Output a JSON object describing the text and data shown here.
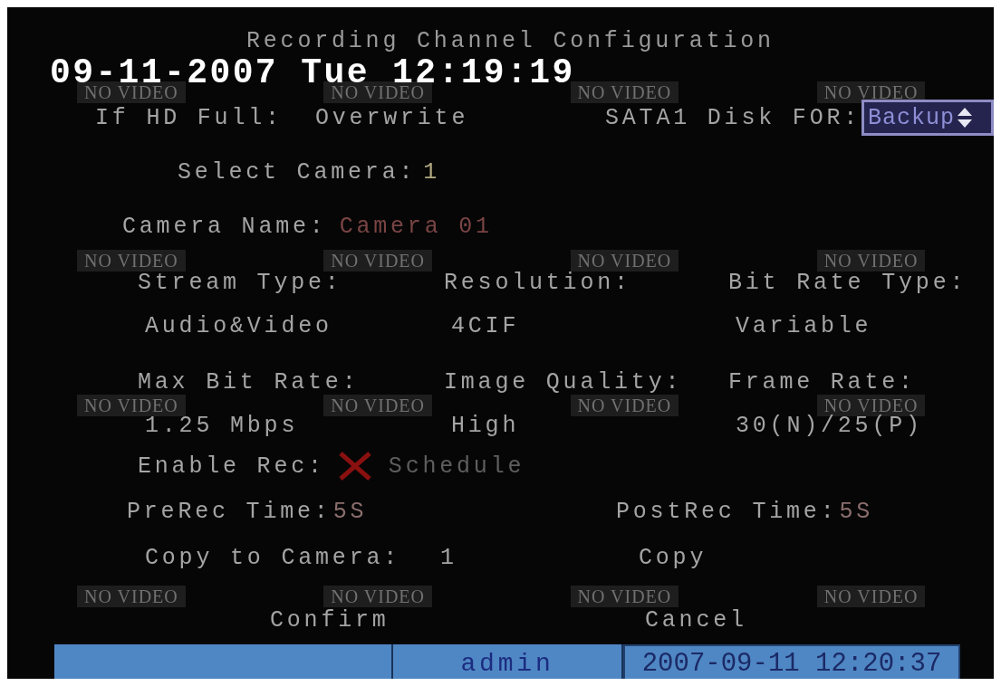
{
  "timestamp": "09-11-2007 Tue 12:19:19",
  "screen_title": "Recording Channel Configuration",
  "video_tiles": [
    {
      "label": "NO VIDEO"
    },
    {
      "label": "NO VIDEO"
    },
    {
      "label": "NO VIDEO"
    },
    {
      "label": "NO VIDEO"
    },
    {
      "label": "NO VIDEO"
    },
    {
      "label": "NO VIDEO"
    },
    {
      "label": "NO VIDEO"
    },
    {
      "label": "NO VIDEO"
    },
    {
      "label": "NO VIDEO"
    },
    {
      "label": "NO VIDEO"
    },
    {
      "label": "NO VIDEO"
    },
    {
      "label": "NO VIDEO"
    },
    {
      "label": "NO VIDEO"
    },
    {
      "label": "NO VIDEO"
    },
    {
      "label": "NO VIDEO"
    },
    {
      "label": "NO VIDEO"
    }
  ],
  "hd_full": {
    "label": "If HD Full:",
    "value": "Overwrite"
  },
  "sata_disk": {
    "label": "SATA1 Disk FOR:",
    "value": "Backup"
  },
  "select_camera": {
    "label": "Select Camera:",
    "value": "1"
  },
  "camera_name": {
    "label": "Camera Name:",
    "value": "Camera 01"
  },
  "settings": [
    {
      "label": "Stream Type:",
      "value": "Audio&Video"
    },
    {
      "label": "Resolution:",
      "value": "4CIF"
    },
    {
      "label": "Bit Rate Type:",
      "value": "Variable"
    },
    {
      "label": "Max Bit Rate:",
      "value": "1.25 Mbps"
    },
    {
      "label": "Image Quality:",
      "value": "High"
    },
    {
      "label": "Frame Rate:",
      "value": "30(N)/25(P)"
    }
  ],
  "enable_rec": {
    "label": "Enable Rec:",
    "checked": false,
    "schedule_button": "Schedule",
    "schedule_disabled": true
  },
  "prerec": {
    "label": "PreRec Time:",
    "value": "5S"
  },
  "postrec": {
    "label": "PostRec Time:",
    "value": "5S"
  },
  "copy": {
    "label": "Copy to Camera:",
    "value": "1",
    "button": "Copy"
  },
  "buttons": [
    "Confirm",
    "Cancel"
  ],
  "status_bar": {
    "user": "admin",
    "datetime": "2007-09-11 12:20:37"
  }
}
